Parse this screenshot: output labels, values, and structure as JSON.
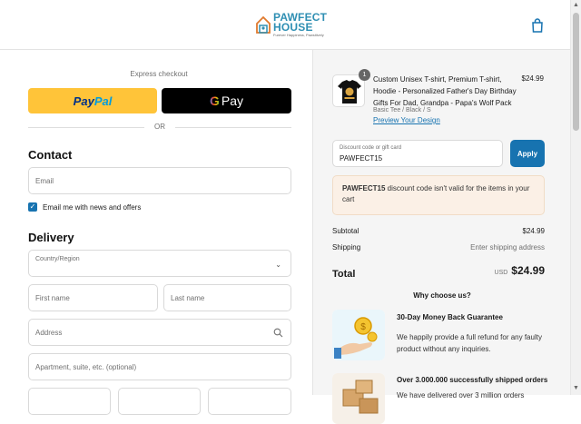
{
  "header": {
    "logo_line1": "PAWFECT",
    "logo_line2": "HOUSE",
    "logo_tagline": "Furever Happiness, Pawsitively"
  },
  "express": {
    "label": "Express checkout",
    "paypal_label_a": "Pay",
    "paypal_label_b": "Pal",
    "gpay_g": "G",
    "gpay_label": "Pay",
    "or_label": "OR"
  },
  "contact": {
    "heading": "Contact",
    "email_placeholder": "Email",
    "newsletter_label": "Email me with news and offers",
    "newsletter_checked": true
  },
  "delivery": {
    "heading": "Delivery",
    "country_label": "Country/Region",
    "first_name_placeholder": "First name",
    "last_name_placeholder": "Last name",
    "address_placeholder": "Address",
    "apartment_placeholder": "Apartment, suite, etc. (optional)"
  },
  "order": {
    "item": {
      "quantity": "1",
      "title": "Custom Unisex T-shirt, Premium T-shirt, Hoodie - Personalized Father's Day Birthday Gifts For Dad, Grandpa - Papa's Wolf Pack",
      "variant": "Basic Tee / Black / S",
      "preview_link": "Preview Your Design",
      "price": "$24.99"
    },
    "discount": {
      "label": "Discount code or gift card",
      "value": "PAWFECT15",
      "apply_label": "Apply",
      "warning_code": "PAWFECT15",
      "warning_text": " discount code isn't valid for the items in your cart"
    },
    "subtotal_label": "Subtotal",
    "subtotal_value": "$24.99",
    "shipping_label": "Shipping",
    "shipping_value": "Enter shipping address",
    "total_label": "Total",
    "total_currency": "USD",
    "total_value": "$24.99"
  },
  "why": {
    "heading": "Why choose us?",
    "benefits": [
      {
        "title": "30-Day Money Back Guarantee",
        "desc": "We happily provide a full refund for any faulty product without any inquiries."
      },
      {
        "title": "Over 3.000.000 successfully shipped orders",
        "desc": "We have delivered over 3 million orders"
      }
    ]
  },
  "colors": {
    "accent": "#1773b0",
    "paypal": "#ffc439",
    "warning_bg": "#fbf0e6"
  }
}
